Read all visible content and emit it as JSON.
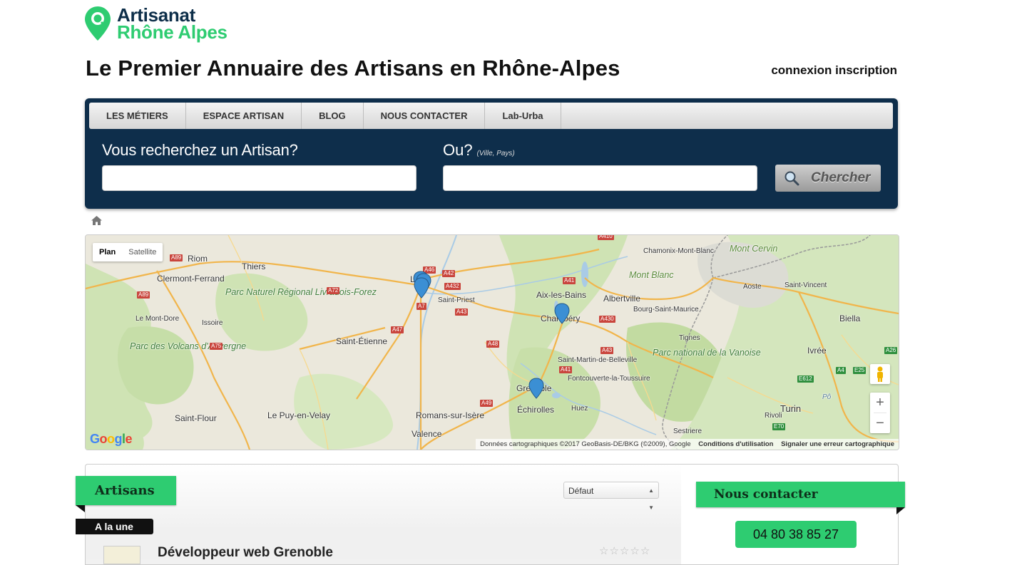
{
  "brand": {
    "line1": "Artisanat",
    "line2": "Rhône Alpes",
    "pin_color": "#2ecc71",
    "navy": "#0e2e4b"
  },
  "headline": "Le Premier Annuaire des Artisans en Rhône-Alpes",
  "auth": {
    "login": "connexion",
    "register": "inscription"
  },
  "nav": {
    "items": [
      "LES MÉTIERS",
      "ESPACE ARTISAN",
      "BLOG",
      "NOUS CONTACTER",
      "Lab-Urba"
    ]
  },
  "search": {
    "what_label": "Vous recherchez un Artisan?",
    "where_label": "Ou?",
    "where_hint": "(Ville, Pays)",
    "what_value": "",
    "where_value": "",
    "button_label": "Chercher",
    "button_icon": "magnifier-icon"
  },
  "breadcrumb": {
    "icon": "home-icon"
  },
  "map": {
    "type_controls": [
      "Plan",
      "Satellite"
    ],
    "active_type": "Plan",
    "cities": [
      "Riom",
      "Thiers",
      "Clermont-Ferrand",
      "Le Mont-Dore",
      "Issoire",
      "Saint-Étienne",
      "Saint-Priest",
      "Saint-Flour",
      "Le Puy-en-Velay",
      "Romans-sur-Isère",
      "Valence",
      "Aix-les-Bains",
      "Albertville",
      "Chambéry",
      "Bourg-Saint-Maurice",
      "Chamonix-Mont-Blanc",
      "Aoste",
      "Saint-Vincent",
      "Biella",
      "Ivrée",
      "Turin",
      "Rivoli",
      "Tignes",
      "Saint-Martin-de-Belleville",
      "Fontcouverte-la-Toussuire",
      "Grenoble",
      "Échirolles",
      "Huez",
      "Sestriere",
      "Pô",
      "Lyon"
    ],
    "parks": [
      "Parc Naturel Régional Livradois-Forez",
      "Parc des Volcans d'Auvergne",
      "Parc national de la Vanoise"
    ],
    "peaks": [
      "Mont Cervin",
      "Mont Blanc"
    ],
    "roads": [
      "A89",
      "A72",
      "A75",
      "A47",
      "A46",
      "A42",
      "A432",
      "A7",
      "A43",
      "A48",
      "A49",
      "A41",
      "A430",
      "A410",
      "E612",
      "A4",
      "E25",
      "A26",
      "E70"
    ],
    "attribution": "Données cartographiques ©2017 GeoBasis-DE/BKG (©2009), Google",
    "terms": "Conditions d'utilisation",
    "report": "Signaler une erreur cartographique",
    "google_logo": "Google",
    "pin_color": "#3b8fd4"
  },
  "listing": {
    "section_title": "Artisans",
    "sort_selected": "Défaut",
    "featured_badge": "A la une",
    "first_entry_title": "Développeur web Grenoble",
    "first_entry_rating": 0,
    "rating_max": 5
  },
  "contact": {
    "title": "Nous contacter",
    "phone": "04 80 38 85 27"
  }
}
